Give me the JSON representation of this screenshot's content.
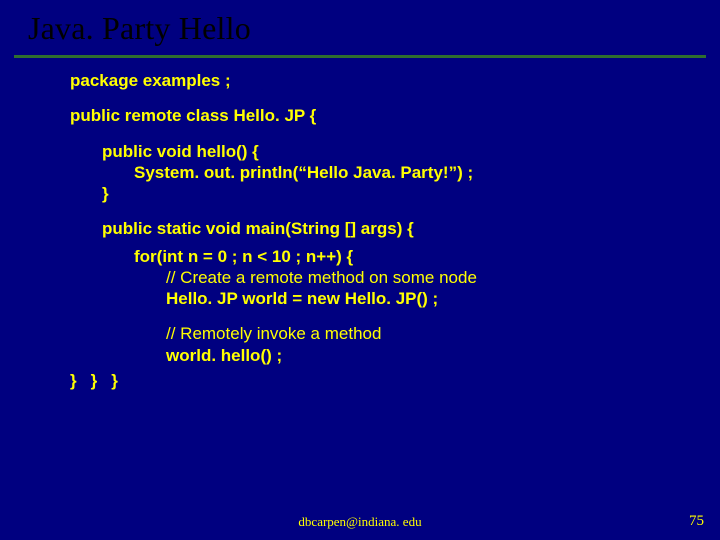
{
  "title": "Java. Party Hello",
  "code": {
    "l0": "package examples ;",
    "l1": "public remote class Hello. JP {",
    "l2": "public void hello() {",
    "l3": "System. out. println(“Hello Java. Party!”) ;",
    "l4": "}",
    "l5": "public static void main(String [] args) {",
    "l6": "for(int n = 0 ; n < 10 ; n++) {",
    "l7": "// Create a remote method on some node",
    "l8": "Hello. JP world = new Hello. JP() ;",
    "l9": "// Remotely invoke a method",
    "l10": "world. hello() ;",
    "close3": "}",
    "close2": "}",
    "close1": "}"
  },
  "footer": "dbcarpen@indiana. edu",
  "pagenum": "75"
}
